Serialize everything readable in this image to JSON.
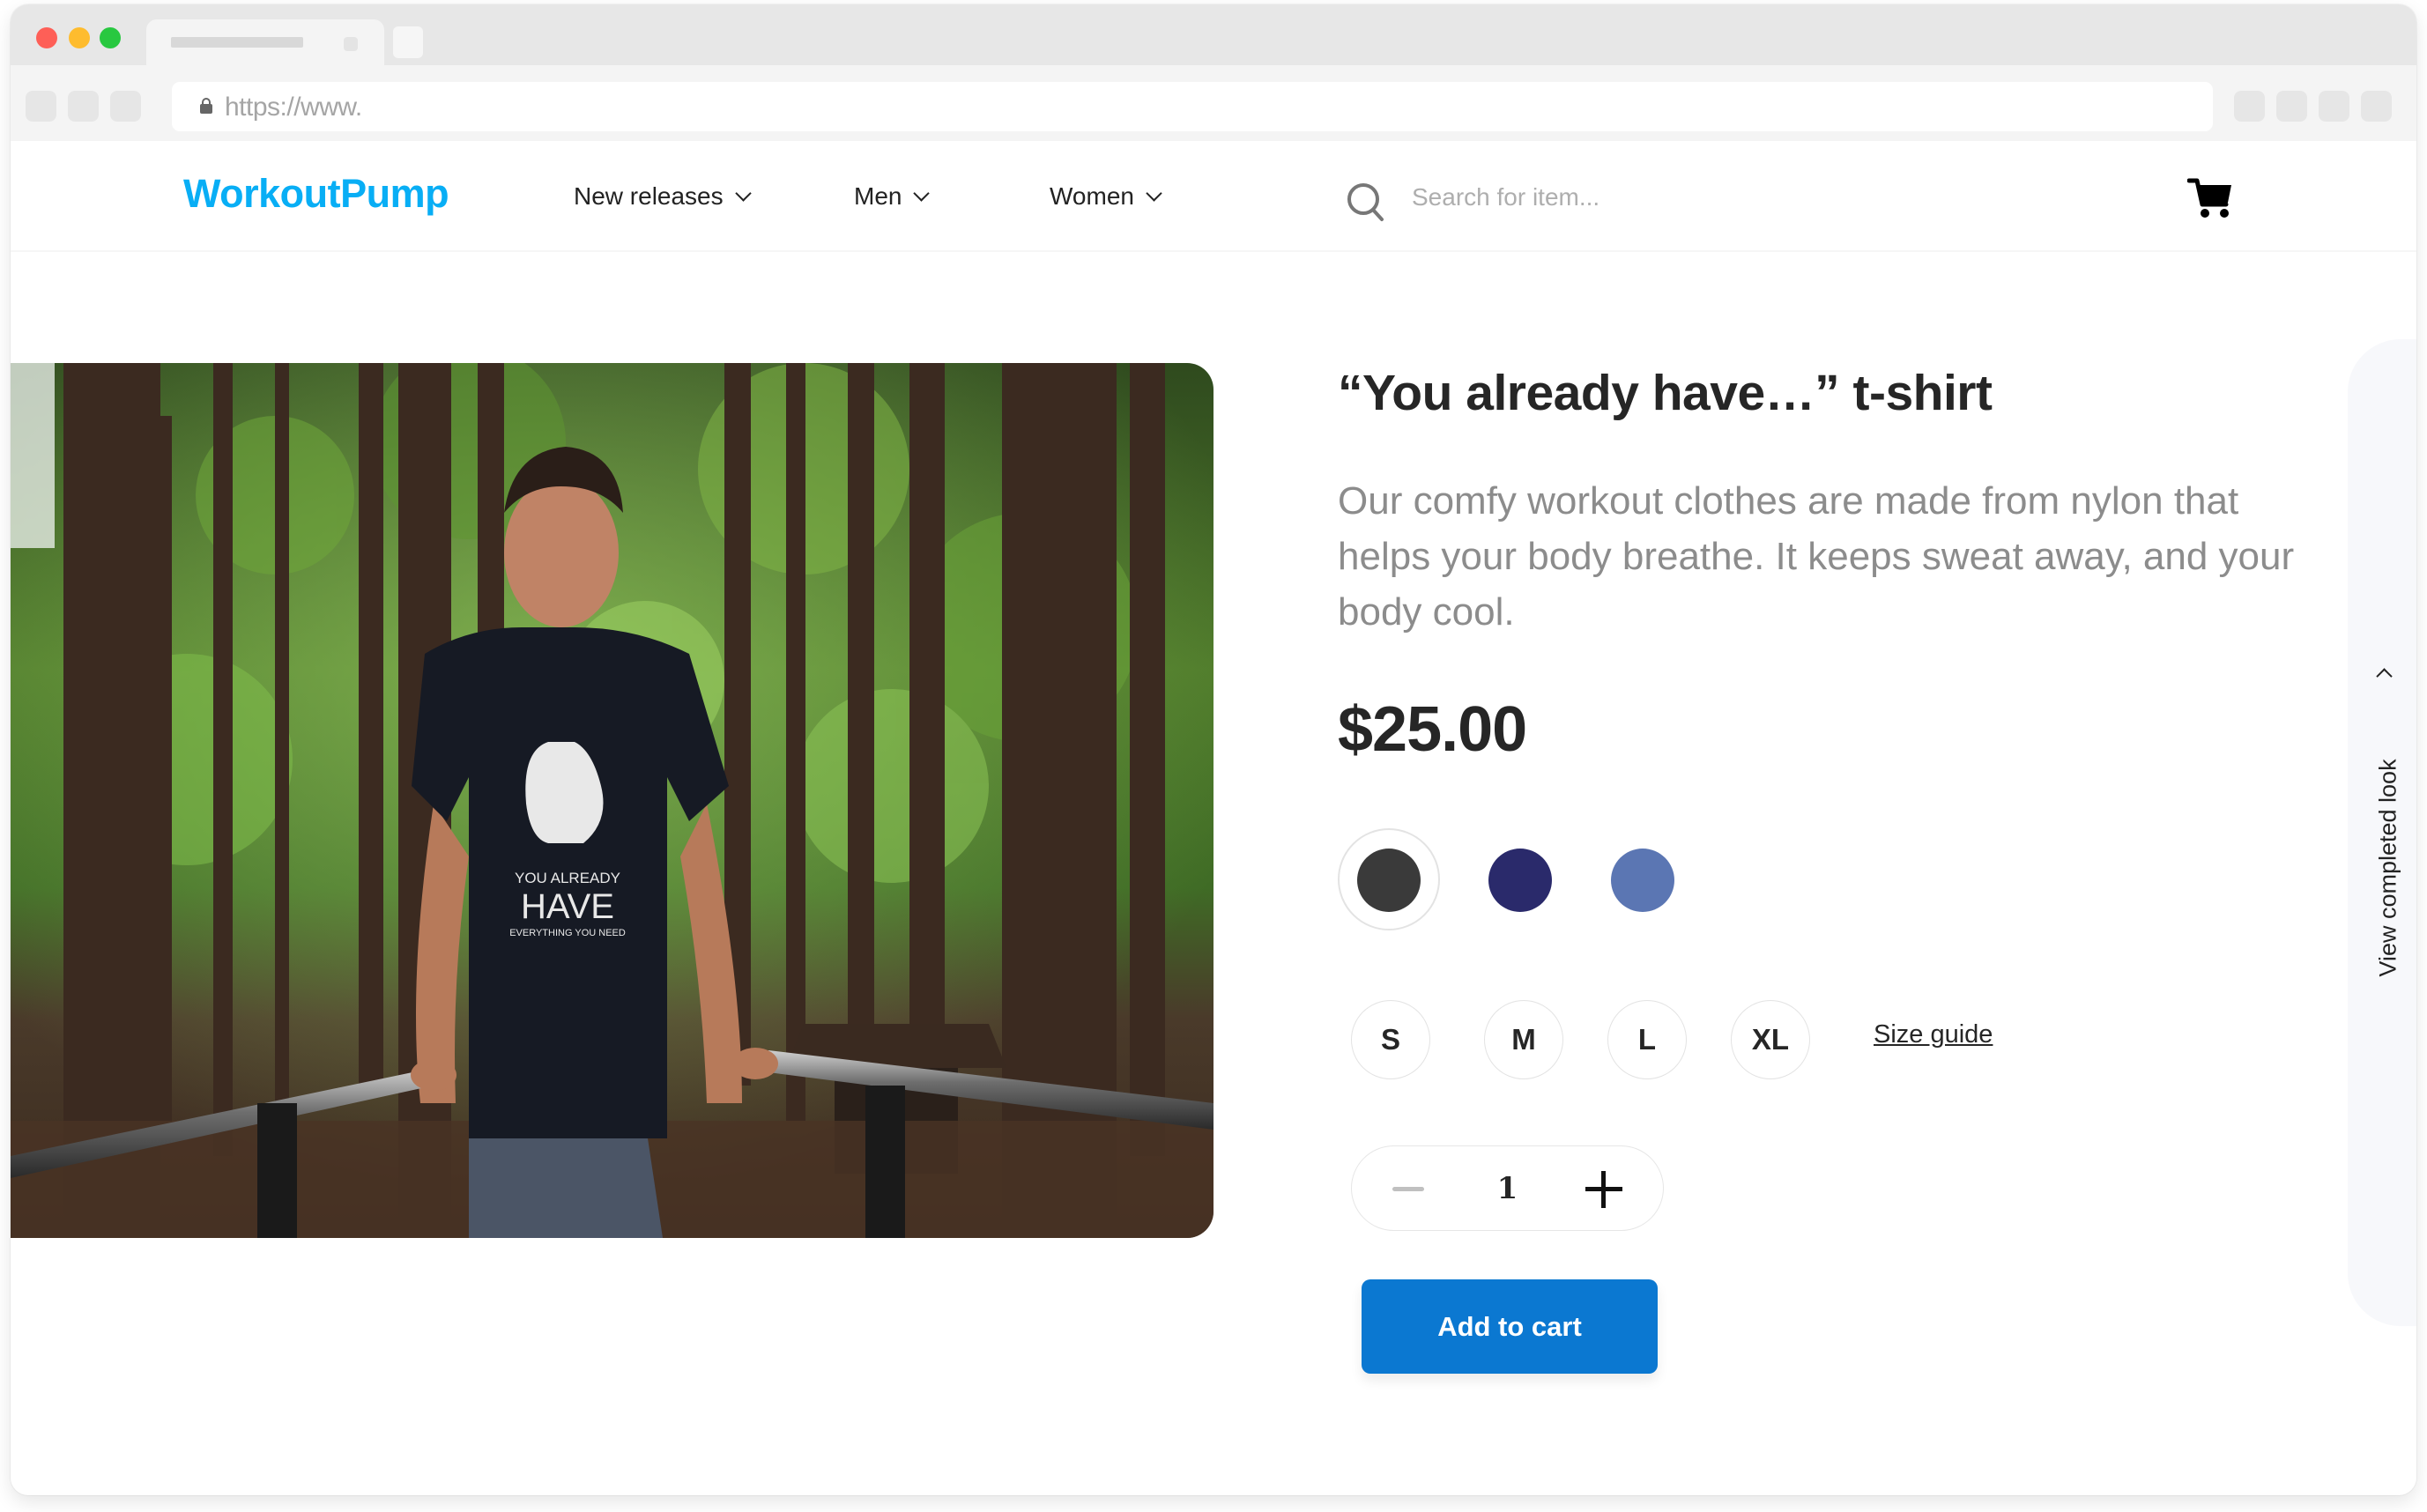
{
  "browser": {
    "url": "https://www."
  },
  "header": {
    "logo": "WorkoutPump",
    "nav": [
      {
        "label": "New releases"
      },
      {
        "label": "Men"
      },
      {
        "label": "Women"
      }
    ],
    "search_placeholder": "Search for item...",
    "search_value": "",
    "icons": {
      "search": "search-icon",
      "cart": "cart-icon"
    },
    "brand_color": "#08aef5"
  },
  "product": {
    "title": "“You already have…” t-shirt",
    "description": "Our comfy workout clothes are made from nylon that helps your body breathe. It keeps sweat away, and your body cool.",
    "price": "$25.00",
    "image_alt": "Man in black \"You already have everything you need\" t-shirt doing dips on parallel bars in a forest",
    "shirt_print": {
      "line1": "YOU ALREADY",
      "line2": "HAVE",
      "line3": "EVERYTHING YOU NEED"
    },
    "colors": [
      {
        "name": "charcoal",
        "hex": "#3a3a3a",
        "selected": true
      },
      {
        "name": "navy",
        "hex": "#2a2a6b",
        "selected": false
      },
      {
        "name": "periwinkle",
        "hex": "#5b76b3",
        "selected": false
      }
    ],
    "sizes": [
      {
        "label": "S"
      },
      {
        "label": "M"
      },
      {
        "label": "L"
      },
      {
        "label": "XL"
      }
    ],
    "size_guide_label": "Size guide",
    "quantity": "1",
    "add_to_cart_label": "Add to cart",
    "accent_color": "#0b78d1"
  },
  "side_panel": {
    "label": "View completed look"
  }
}
